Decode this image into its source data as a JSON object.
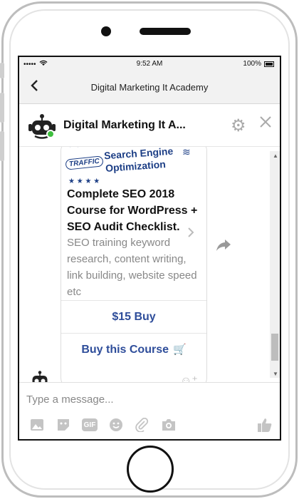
{
  "status_bar": {
    "signal": "•••••",
    "time": "9:52 AM",
    "battery": "100%"
  },
  "header": {
    "back_icon": "chevron-left",
    "title": "Digital Marketing It Academy"
  },
  "chat": {
    "title": "Digital Marketing It A...",
    "online": true,
    "settings_icon": "gear",
    "close_icon": "close"
  },
  "card": {
    "image": {
      "tag": "TRAFFIC",
      "line1": "Search Engine",
      "line2": "Optimization"
    },
    "title": "Complete SEO 2018 Course for WordPress + SEO Audit Checklist.",
    "description": "SEO training keyword research, content writing, link building, website speed etc",
    "buttons": [
      {
        "label": "$15 Buy"
      },
      {
        "label": "Buy this Course"
      }
    ]
  },
  "composer": {
    "placeholder": "Type a message...",
    "gif_label": "GIF",
    "tools": [
      "image-icon",
      "sticker-icon",
      "gif-icon",
      "emoji-icon",
      "attach-icon",
      "camera-icon"
    ],
    "like_icon": "thumbs-up"
  },
  "colors": {
    "accent": "#2e4d9a",
    "online": "#3fbf3f",
    "muted_icon": "#bdbdbd"
  }
}
